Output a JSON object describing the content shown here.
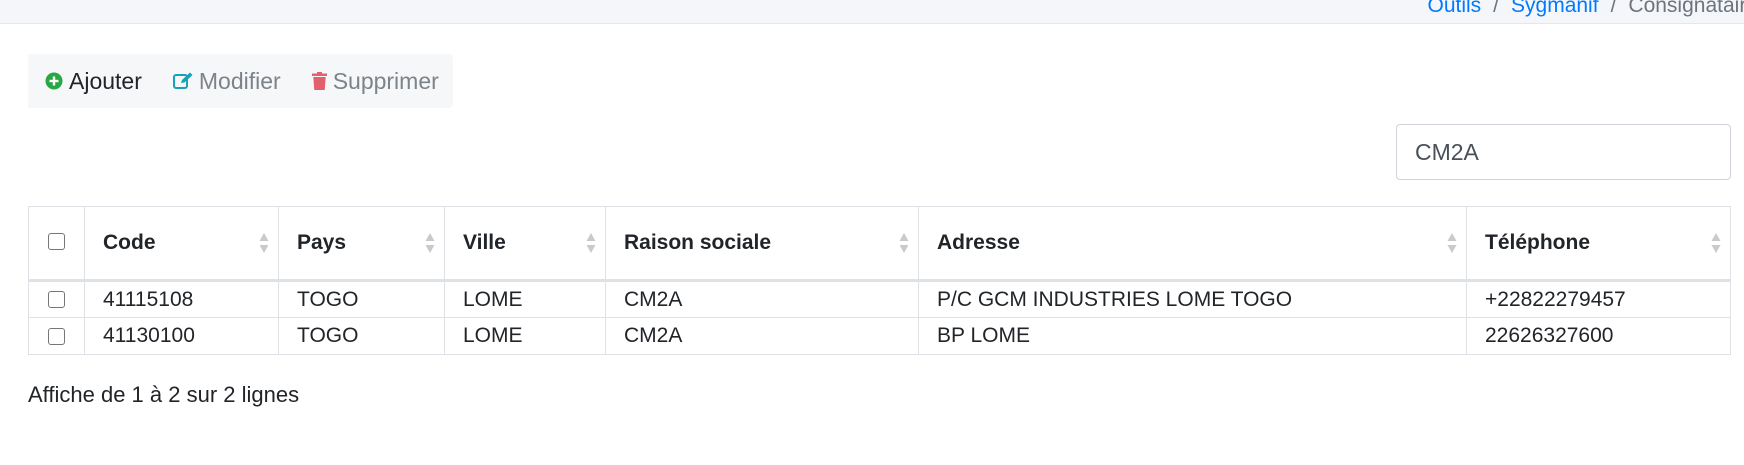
{
  "breadcrumb": {
    "items": [
      "Outils",
      "Sygmanif",
      "Consignataire"
    ]
  },
  "toolbar": {
    "add_label": "Ajouter",
    "edit_label": "Modifier",
    "delete_label": "Supprimer"
  },
  "search": {
    "value": "CM2A"
  },
  "table": {
    "columns": [
      "Code",
      "Pays",
      "Ville",
      "Raison sociale",
      "Adresse",
      "Téléphone"
    ],
    "rows": [
      {
        "code": "41115108",
        "pays": "TOGO",
        "ville": "LOME",
        "raison_sociale": "CM2A",
        "adresse": "P/C GCM INDUSTRIES LOME TOGO",
        "telephone": "+22822279457"
      },
      {
        "code": "41130100",
        "pays": "TOGO",
        "ville": "LOME",
        "raison_sociale": "CM2A",
        "adresse": "BP LOME",
        "telephone": "22626327600"
      }
    ]
  },
  "footer": {
    "summary": "Affiche de 1 à 2 sur 2 lignes"
  },
  "colors": {
    "link": "#007bff",
    "add_icon": "#28a745",
    "edit_icon": "#17a2b8",
    "delete_icon": "#e4606d"
  },
  "icons": {
    "add": "plus-circle-icon",
    "edit": "edit-icon",
    "delete": "trash-icon",
    "sort": "sort-icon"
  }
}
